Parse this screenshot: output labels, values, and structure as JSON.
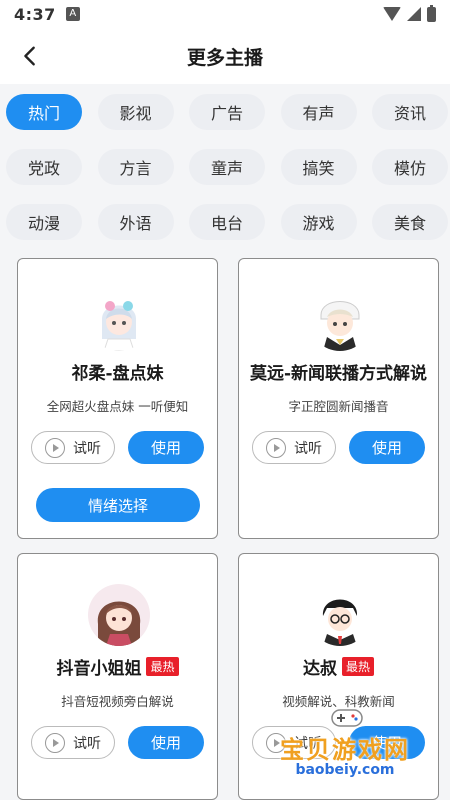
{
  "status": {
    "time": "4:37",
    "sim_label": "A"
  },
  "header": {
    "title": "更多主播"
  },
  "categories": [
    "热门",
    "影视",
    "广告",
    "有声",
    "资讯",
    "党政",
    "方言",
    "童声",
    "搞笑",
    "模仿",
    "动漫",
    "外语",
    "电台",
    "游戏",
    "美食"
  ],
  "active_category": "热门",
  "cards": [
    {
      "name": "祁柔-盘点妹",
      "desc": "全网超火盘点妹 一听便知",
      "badge": "",
      "listen": "试听",
      "use": "使用",
      "emotion": "情绪选择"
    },
    {
      "name": "莫远-新闻联播方式解说",
      "desc": "字正腔圆新闻播音",
      "badge": "",
      "listen": "试听",
      "use": "使用"
    },
    {
      "name": "抖音小姐姐",
      "desc": "抖音短视频旁白解说",
      "badge": "最热",
      "listen": "试听",
      "use": "使用"
    },
    {
      "name": "达叔",
      "desc": "视频解说、科教新闻",
      "badge": "最热",
      "listen": "试听",
      "use": "使用"
    }
  ],
  "watermark": {
    "text": "宝贝游戏网",
    "url": "baobeiy.com"
  },
  "colors": {
    "accent": "#1f8ef1",
    "badge": "#e8202a",
    "background": "#f4f5f7"
  }
}
